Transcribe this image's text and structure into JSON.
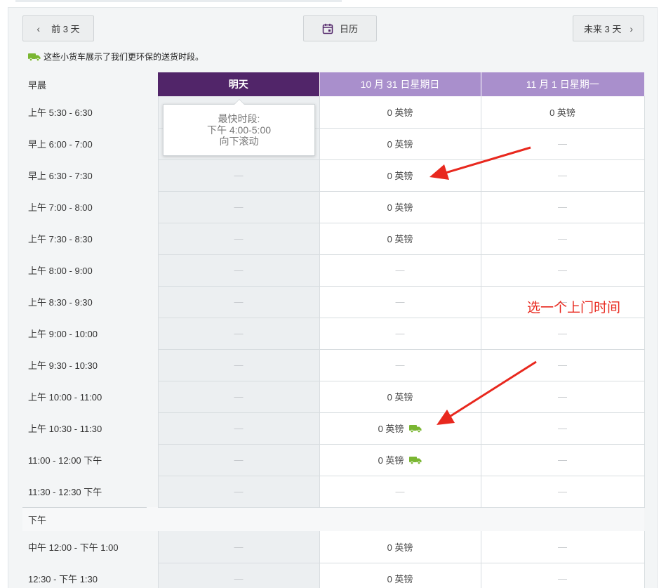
{
  "nav": {
    "prev_label": "前 3 天",
    "calendar_label": "日历",
    "next_label": "未来 3 天"
  },
  "note": "这些小货车展示了我们更环保的送货时段。",
  "header": {
    "section_label": "早晨",
    "columns": [
      "明天",
      "10 月 31 日星期日",
      "11 月 1 日星期一"
    ]
  },
  "tooltip": {
    "line1": "最快时段:",
    "line2": "下午 4:00-5:00",
    "line3": "向下滚动"
  },
  "morning_slots": [
    {
      "time": "上午 5:30 - 6:30",
      "cells": [
        "",
        "0 英镑",
        "0 英镑"
      ],
      "green": [
        false,
        false,
        false
      ]
    },
    {
      "time": "早上 6:00 - 7:00",
      "cells": [
        "",
        "0 英镑",
        "—"
      ],
      "green": [
        false,
        false,
        false
      ]
    },
    {
      "time": "早上 6:30 - 7:30",
      "cells": [
        "—",
        "0 英镑",
        "—"
      ],
      "green": [
        false,
        false,
        false
      ]
    },
    {
      "time": "上午 7:00 - 8:00",
      "cells": [
        "—",
        "0 英镑",
        "—"
      ],
      "green": [
        false,
        false,
        false
      ]
    },
    {
      "time": "上午 7:30 - 8:30",
      "cells": [
        "—",
        "0 英镑",
        "—"
      ],
      "green": [
        false,
        false,
        false
      ]
    },
    {
      "time": "上午 8:00 - 9:00",
      "cells": [
        "—",
        "—",
        "—"
      ],
      "green": [
        false,
        false,
        false
      ]
    },
    {
      "time": "上午 8:30 - 9:30",
      "cells": [
        "—",
        "—",
        "—"
      ],
      "green": [
        false,
        false,
        false
      ]
    },
    {
      "time": "上午 9:00 - 10:00",
      "cells": [
        "—",
        "—",
        "—"
      ],
      "green": [
        false,
        false,
        false
      ]
    },
    {
      "time": "上午 9:30 - 10:30",
      "cells": [
        "—",
        "—",
        "—"
      ],
      "green": [
        false,
        false,
        false
      ]
    },
    {
      "time": "上午 10:00 - 11:00",
      "cells": [
        "—",
        "0 英镑",
        "—"
      ],
      "green": [
        false,
        false,
        false
      ]
    },
    {
      "time": "上午 10:30 - 11:30",
      "cells": [
        "—",
        "0 英镑",
        "—"
      ],
      "green": [
        false,
        true,
        false
      ]
    },
    {
      "time": "11:00 - 12:00 下午",
      "cells": [
        "—",
        "0 英镑",
        "—"
      ],
      "green": [
        false,
        true,
        false
      ]
    },
    {
      "time": "11:30 - 12:30 下午",
      "cells": [
        "—",
        "—",
        "—"
      ],
      "green": [
        false,
        false,
        false
      ]
    }
  ],
  "afternoon_label": "下午",
  "afternoon_slots": [
    {
      "time": "中午 12:00 - 下午 1:00",
      "cells": [
        "—",
        "0 英镑",
        "—"
      ],
      "green": [
        false,
        false,
        false
      ]
    },
    {
      "time": "12:30 - 下午 1:30",
      "cells": [
        "—",
        "0 英镑",
        "—"
      ],
      "green": [
        false,
        false,
        false
      ]
    }
  ],
  "annotation": "选一个上门时间",
  "colors": {
    "tomorrow_header": "#512569",
    "day_header": "#a98fcc",
    "green_truck": "#7ab632",
    "annotation_red": "#e8281e"
  }
}
